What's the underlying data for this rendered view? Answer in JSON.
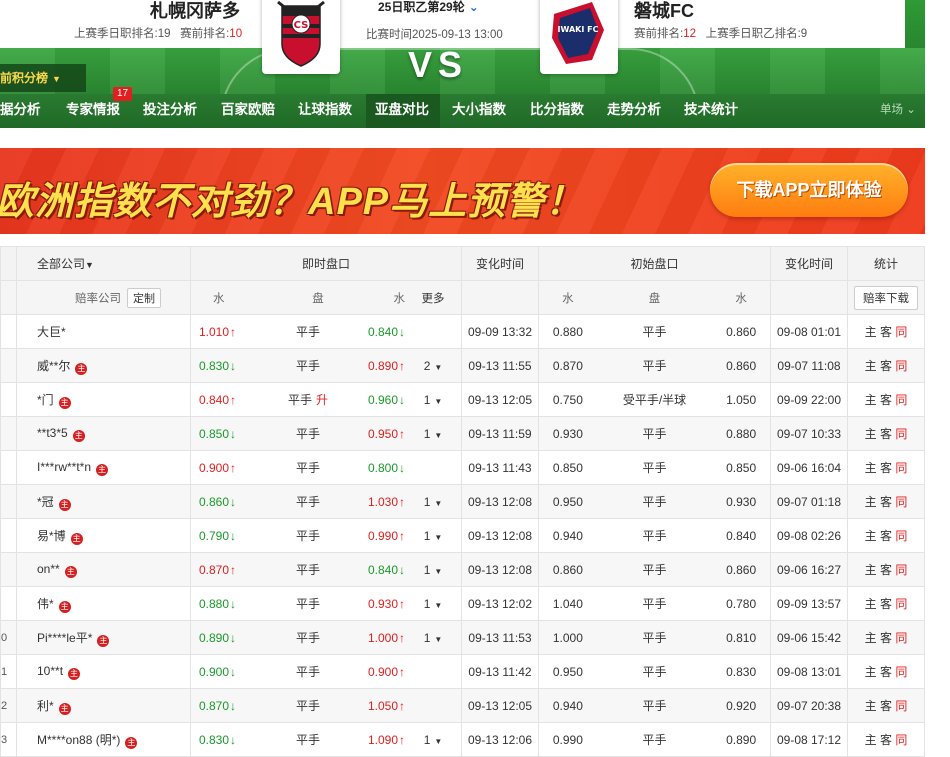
{
  "header": {
    "home_team": "札幌冈萨多",
    "home_rank_prefix": "上赛季日职排名:19",
    "home_rank_label": "赛前排名:",
    "home_rank_value": "10",
    "round": "25日职乙第29轮",
    "match_time": "比赛时间2025-09-13 13:00",
    "vs": "VS",
    "away_team": "磐城FC",
    "away_rank_label": "赛前排名:",
    "away_rank_value": "12",
    "away_rank_suffix": "上赛季日职乙排名:9",
    "rank_tab": "前积分榜",
    "away_logo_text": "IWAKI FC"
  },
  "nav": {
    "items": [
      "据分析",
      "专家情报",
      "投注分析",
      "百家欧赔",
      "让球指数",
      "亚盘对比",
      "大小指数",
      "比分指数",
      "走势分析",
      "技术统计"
    ],
    "active_index": 5,
    "badge": "17",
    "right": "单场"
  },
  "banner": {
    "text": "欧洲指数不对劲？APP马上预警！",
    "button": "下载APP立即体验"
  },
  "table": {
    "head1": {
      "company_filter": "全部公司",
      "live": "即时盘口",
      "change_time": "变化时间",
      "initial": "初始盘口",
      "change_time2": "变化时间",
      "stats": "统计"
    },
    "head2": {
      "company": "赔率公司",
      "custom": "定制",
      "water1": "水",
      "handicap": "盘",
      "water2": "水",
      "more": "更多",
      "init_water1": "水",
      "init_handicap": "盘",
      "init_water2": "水",
      "download": "赔率下载"
    },
    "stats_labels": {
      "home": "主",
      "away": "客",
      "same": "同"
    },
    "rows": [
      {
        "idx": "",
        "company": "大巨*",
        "badge": false,
        "w1": "1.010",
        "w1d": "up",
        "hand": "平手",
        "shift": "",
        "w2": "0.840",
        "w2d": "down",
        "more": "",
        "time": "09-09 13:32",
        "iw1": "0.880",
        "ihand": "平手",
        "iw2": "0.860",
        "itime": "09-08 01:01"
      },
      {
        "idx": "",
        "company": "威**尔",
        "badge": true,
        "w1": "0.830",
        "w1d": "down",
        "hand": "平手",
        "shift": "",
        "w2": "0.890",
        "w2d": "up",
        "more": "2",
        "time": "09-13 11:55",
        "iw1": "0.870",
        "ihand": "平手",
        "iw2": "0.860",
        "itime": "09-07 11:08"
      },
      {
        "idx": "",
        "company": "*门",
        "badge": true,
        "w1": "0.840",
        "w1d": "up",
        "hand": "平手",
        "shift": "升",
        "w2": "0.960",
        "w2d": "down",
        "more": "1",
        "time": "09-13 12:05",
        "iw1": "0.750",
        "ihand": "受平手/半球",
        "iw2": "1.050",
        "itime": "09-09 22:00"
      },
      {
        "idx": "",
        "company": "**t3*5",
        "badge": true,
        "w1": "0.850",
        "w1d": "down",
        "hand": "平手",
        "shift": "",
        "w2": "0.950",
        "w2d": "up",
        "more": "1",
        "time": "09-13 11:59",
        "iw1": "0.930",
        "ihand": "平手",
        "iw2": "0.880",
        "itime": "09-07 10:33"
      },
      {
        "idx": "",
        "company": "I***rw**t*n",
        "badge": true,
        "w1": "0.900",
        "w1d": "up",
        "hand": "平手",
        "shift": "",
        "w2": "0.800",
        "w2d": "down",
        "more": "",
        "time": "09-13 11:43",
        "iw1": "0.850",
        "ihand": "平手",
        "iw2": "0.850",
        "itime": "09-06 16:04"
      },
      {
        "idx": "",
        "company": "*冠",
        "badge": true,
        "w1": "0.860",
        "w1d": "down",
        "hand": "平手",
        "shift": "",
        "w2": "1.030",
        "w2d": "up",
        "more": "1",
        "time": "09-13 12:08",
        "iw1": "0.950",
        "ihand": "平手",
        "iw2": "0.930",
        "itime": "09-07 01:18"
      },
      {
        "idx": "",
        "company": "易*博",
        "badge": true,
        "w1": "0.790",
        "w1d": "down",
        "hand": "平手",
        "shift": "",
        "w2": "0.990",
        "w2d": "up",
        "more": "1",
        "time": "09-13 12:08",
        "iw1": "0.940",
        "ihand": "平手",
        "iw2": "0.840",
        "itime": "09-08 02:26"
      },
      {
        "idx": "",
        "company": "on**",
        "badge": true,
        "w1": "0.870",
        "w1d": "up",
        "hand": "平手",
        "shift": "",
        "w2": "0.840",
        "w2d": "down",
        "more": "1",
        "time": "09-13 12:08",
        "iw1": "0.860",
        "ihand": "平手",
        "iw2": "0.860",
        "itime": "09-06 16:27"
      },
      {
        "idx": "",
        "company": "伟*",
        "badge": true,
        "w1": "0.880",
        "w1d": "down",
        "hand": "平手",
        "shift": "",
        "w2": "0.930",
        "w2d": "up",
        "more": "1",
        "time": "09-13 12:02",
        "iw1": "1.040",
        "ihand": "平手",
        "iw2": "0.780",
        "itime": "09-09 13:57"
      },
      {
        "idx": "0",
        "company": "Pi****le平*",
        "badge": true,
        "w1": "0.890",
        "w1d": "down",
        "hand": "平手",
        "shift": "",
        "w2": "1.000",
        "w2d": "up",
        "more": "1",
        "time": "09-13 11:53",
        "iw1": "1.000",
        "ihand": "平手",
        "iw2": "0.810",
        "itime": "09-06 15:42"
      },
      {
        "idx": "1",
        "company": "10**t",
        "badge": true,
        "w1": "0.900",
        "w1d": "down",
        "hand": "平手",
        "shift": "",
        "w2": "0.900",
        "w2d": "up",
        "more": "",
        "time": "09-13 11:42",
        "iw1": "0.950",
        "ihand": "平手",
        "iw2": "0.830",
        "itime": "09-08 13:01"
      },
      {
        "idx": "2",
        "company": "利*",
        "badge": true,
        "w1": "0.870",
        "w1d": "down",
        "hand": "平手",
        "shift": "",
        "w2": "1.050",
        "w2d": "up",
        "more": "",
        "time": "09-13 12:05",
        "iw1": "0.940",
        "ihand": "平手",
        "iw2": "0.920",
        "itime": "09-07 20:38"
      },
      {
        "idx": "3",
        "company": "M****on88 (明*)",
        "badge": true,
        "w1": "0.830",
        "w1d": "down",
        "hand": "平手",
        "shift": "",
        "w2": "1.090",
        "w2d": "up",
        "more": "1",
        "time": "09-13 12:06",
        "iw1": "0.990",
        "ihand": "平手",
        "iw2": "0.890",
        "itime": "09-08 17:12"
      }
    ]
  }
}
